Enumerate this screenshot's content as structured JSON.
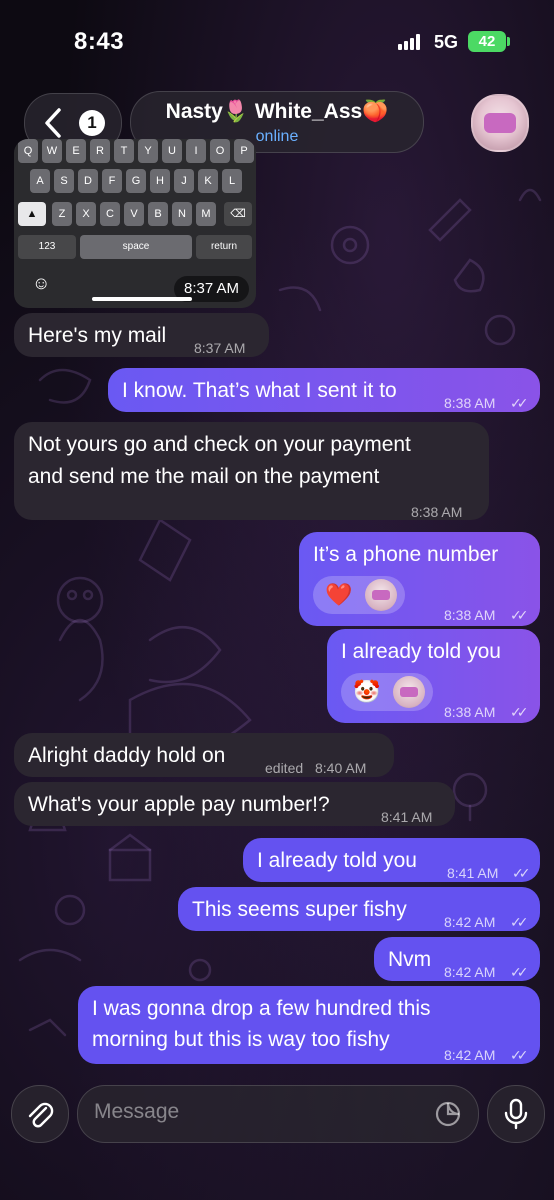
{
  "status_bar": {
    "time": "8:43",
    "network": "5G",
    "battery": "42"
  },
  "header": {
    "back_count": "1",
    "contact_name": "Nasty🌷 White_Ass🍑",
    "contact_status": "online"
  },
  "image_message": {
    "time": "8:37 AM",
    "keyboard_rows": [
      [
        "Q",
        "W",
        "E",
        "R",
        "T",
        "Y",
        "U",
        "I",
        "O",
        "P"
      ],
      [
        "A",
        "S",
        "D",
        "F",
        "G",
        "H",
        "J",
        "K",
        "L"
      ],
      [
        "Z",
        "X",
        "C",
        "V",
        "B",
        "N",
        "M"
      ]
    ],
    "key_123": "123",
    "key_space": "space",
    "key_return": "return"
  },
  "messages": [
    {
      "id": "m1",
      "direction": "in",
      "text": "Here's my mail",
      "time": "8:37 AM"
    },
    {
      "id": "m2",
      "direction": "out",
      "text": "I know. That’s what I sent it to",
      "time": "8:38 AM"
    },
    {
      "id": "m3",
      "direction": "in",
      "lines": [
        "Not yours go and check on your payment",
        "and send me the mail on the payment"
      ],
      "time": "8:38 AM"
    },
    {
      "id": "m4",
      "direction": "out",
      "text": "It’s a phone number",
      "time": "8:38 AM",
      "reaction": "❤️"
    },
    {
      "id": "m5",
      "direction": "out",
      "text": "I already told you",
      "time": "8:38 AM",
      "reaction": "🤡"
    },
    {
      "id": "m6",
      "direction": "in",
      "text": "Alright daddy hold on",
      "edited": "edited",
      "time": "8:40 AM"
    },
    {
      "id": "m7",
      "direction": "in",
      "text": "What's your apple pay number!?",
      "time": "8:41 AM"
    },
    {
      "id": "m8",
      "direction": "out",
      "text": "I already told you",
      "time": "8:41 AM"
    },
    {
      "id": "m9",
      "direction": "out",
      "text": "This seems super fishy",
      "time": "8:42 AM"
    },
    {
      "id": "m10",
      "direction": "out",
      "text": "Nvm",
      "time": "8:42 AM"
    },
    {
      "id": "m11",
      "direction": "out",
      "lines": [
        "I was gonna drop a few hundred this",
        "morning but this is way too fishy"
      ],
      "time": "8:42 AM"
    }
  ],
  "composer": {
    "placeholder": "Message"
  },
  "icons": {
    "back": "chevron-left-icon",
    "attach": "paperclip-icon",
    "sticker": "sticker-icon",
    "mic": "microphone-icon",
    "read": "double-check-icon"
  },
  "colors": {
    "incoming_bubble": "#2b2630",
    "outgoing_bubble": "#6a59f3",
    "online": "#6ab0ff",
    "battery": "#4cd964"
  }
}
